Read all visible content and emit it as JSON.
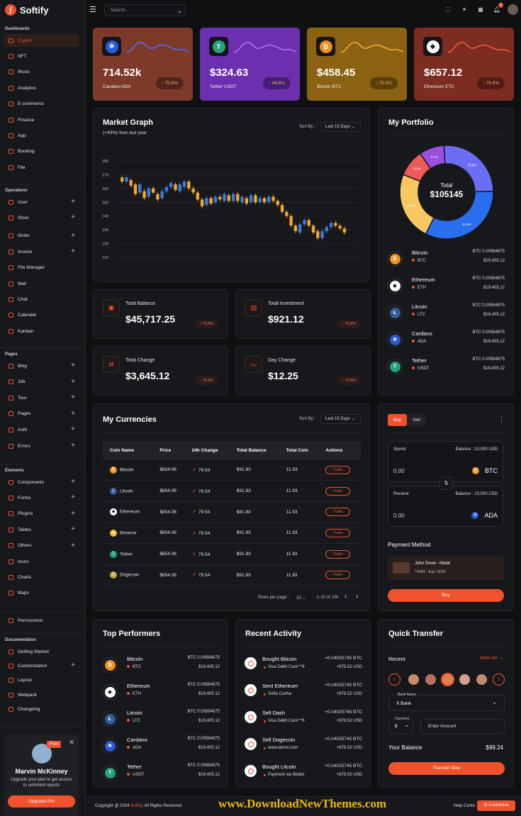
{
  "brand": "Softify",
  "sidebar": {
    "sections": [
      "Dashboards",
      "Operations",
      "Pages",
      "Elements",
      "Documentation"
    ],
    "dashboards": [
      "Crypto",
      "NFT",
      "Music",
      "Analytics",
      "E-commerce",
      "Finance",
      "App",
      "Booking",
      "File"
    ],
    "operations": [
      "User",
      "Store",
      "Order",
      "Invoice",
      "File Manager",
      "Mail",
      "Chat",
      "Calendar",
      "Kanban"
    ],
    "pages": [
      "Blog",
      "Job",
      "Tour",
      "Pages",
      "Auth",
      "Errors"
    ],
    "elements": [
      "Components",
      "Forms",
      "Plugins",
      "Tables",
      "Others",
      "Icons",
      "Charts",
      "Maps",
      "Permissions"
    ],
    "documentation": [
      "Getting Started",
      "Customization",
      "Layout",
      "Webpack",
      "Changelog"
    ],
    "promo": {
      "badge": "Free",
      "name": "Marvin McKinney",
      "desc": "Upgrade your plan to get access to unlimited reports",
      "button": "Upgrade Pro"
    }
  },
  "topbar": {
    "search_placeholder": "Search...",
    "notif_count": "2"
  },
  "stats": [
    {
      "value": "714.52k",
      "label": "Cardano ADA",
      "pct": "75.8%",
      "color": "#7d3a2b",
      "coin": "#2a5bd7",
      "glyph": "✲",
      "line": "#4f6df0"
    },
    {
      "value": "$324.63",
      "label": "Tether USDT",
      "pct": "44.8%",
      "color": "#6b2fb0",
      "coin": "#26a17b",
      "glyph": "T",
      "line": "#b06ff5"
    },
    {
      "value": "$458.45",
      "label": "Bitcoin BTC",
      "pct": "75.8%",
      "color": "#8a6211",
      "coin": "#f0901a",
      "glyph": "₿",
      "line": "#f0b030"
    },
    {
      "value": "$657.12",
      "label": "Ethereum ETC",
      "pct": "75.8%",
      "color": "#7d2c22",
      "coin": "#ffffff",
      "glyph": "◆",
      "line": "#f05a30"
    }
  ],
  "market": {
    "title": "Market Graph",
    "subtitle": "(+43%) than last year",
    "sort_label": "Sort By :",
    "sort_value": "Last 15 Days",
    "yticks": [
      "180",
      "170",
      "160",
      "150",
      "140",
      "130",
      "120",
      "110"
    ]
  },
  "chart_data": {
    "type": "candlestick",
    "title": "Market Graph",
    "y_ticks": [
      180,
      170,
      160,
      150,
      140,
      130,
      120,
      110
    ],
    "ylim": [
      110,
      180
    ],
    "candles": [
      [
        168,
        165
      ],
      [
        165,
        168
      ],
      [
        166,
        162
      ],
      [
        163,
        156
      ],
      [
        157,
        163
      ],
      [
        158,
        153
      ],
      [
        154,
        160
      ],
      [
        160,
        157
      ],
      [
        156,
        152
      ],
      [
        153,
        158
      ],
      [
        158,
        161
      ],
      [
        161,
        164
      ],
      [
        163,
        159
      ],
      [
        158,
        163
      ],
      [
        161,
        165
      ],
      [
        165,
        160
      ],
      [
        160,
        157
      ],
      [
        157,
        152
      ],
      [
        152,
        147
      ],
      [
        148,
        153
      ],
      [
        153,
        149
      ],
      [
        150,
        154
      ],
      [
        154,
        152
      ],
      [
        151,
        156
      ],
      [
        155,
        151
      ],
      [
        151,
        156
      ],
      [
        156,
        151
      ],
      [
        150,
        154
      ],
      [
        153,
        149
      ],
      [
        150,
        155
      ],
      [
        155,
        150
      ],
      [
        150,
        153
      ],
      [
        153,
        150
      ],
      [
        150,
        154
      ],
      [
        154,
        151
      ],
      [
        151,
        148
      ],
      [
        148,
        143
      ],
      [
        143,
        140
      ],
      [
        140,
        133
      ],
      [
        133,
        129
      ],
      [
        128,
        134
      ],
      [
        134,
        137
      ],
      [
        137,
        133
      ],
      [
        133,
        128
      ],
      [
        129,
        124
      ],
      [
        124,
        129
      ],
      [
        129,
        132
      ],
      [
        132,
        135
      ],
      [
        135,
        133
      ],
      [
        133,
        131
      ],
      [
        131,
        128
      ]
    ]
  },
  "balances": [
    {
      "label": "Total Balance",
      "value": "$45,717.25",
      "pct": "75.8%",
      "icon": "▣"
    },
    {
      "label": "Total Investment",
      "value": "$921.12",
      "pct": "75.8%",
      "icon": "▤"
    },
    {
      "label": "Total Change",
      "value": "$3,645.12",
      "pct": "75.8%",
      "icon": "⇄"
    },
    {
      "label": "Day Change",
      "value": "$12.25",
      "pct": "75.8%",
      "icon": "▭"
    }
  ],
  "portfolio": {
    "title": "My Portfolio",
    "total_label": "Total",
    "total_value": "$105145",
    "slices": [
      {
        "label": "8.7%",
        "value": 8.7,
        "color": "#9b4fe0"
      },
      {
        "label": "25.6%",
        "value": 25.6,
        "color": "#6b6df5"
      },
      {
        "label": "32.6%",
        "value": 32.6,
        "color": "#2a6ef0"
      },
      {
        "label": "23.8%",
        "value": 23.8,
        "color": "#f6c85f"
      },
      {
        "label": "9.9%",
        "value": 9.3,
        "color": "#f0595a"
      }
    ],
    "items": [
      {
        "name": "Bitcoin",
        "sym": "BTC",
        "btc": "BTC 0.00584875",
        "usd": "$19,405.12",
        "c": "#f0901a",
        "g": "₿"
      },
      {
        "name": "Ethereum",
        "sym": "ETH",
        "btc": "BTC 0.00584875",
        "usd": "$19,405.12",
        "c": "#ffffff",
        "g": "◆"
      },
      {
        "name": "Litcoin",
        "sym": "LTC",
        "btc": "BTC 0.00584875",
        "usd": "$19,405.12",
        "c": "#345d9d",
        "g": "Ł"
      },
      {
        "name": "Cardano",
        "sym": "ADA",
        "btc": "BTC 0.00584875",
        "usd": "$19,405.12",
        "c": "#2a5bd7",
        "g": "✲"
      },
      {
        "name": "Tether",
        "sym": "USDT",
        "btc": "BTC 0.00584875",
        "usd": "$19,405.12",
        "c": "#26a17b",
        "g": "T"
      }
    ]
  },
  "currencies": {
    "title": "My Currencies",
    "sort_label": "Sort By :",
    "sort_value": "Last 15 Days",
    "headers": [
      "Coin Name",
      "Price",
      "24h Change",
      "Total Balance",
      "Total Coin",
      "Actions"
    ],
    "rows": [
      {
        "name": "Bitcoin",
        "price": "$854.08",
        "change": "79.54",
        "bal": "$91.83",
        "coin": "11.93",
        "c": "#f0901a",
        "g": "₿"
      },
      {
        "name": "Litcoin",
        "price": "$854.08",
        "change": "79.54",
        "bal": "$91.83",
        "coin": "11.93",
        "c": "#345d9d",
        "g": "Ł"
      },
      {
        "name": "Ethereum",
        "price": "$854.08",
        "change": "79.54",
        "bal": "$91.83",
        "coin": "11.93",
        "c": "#ffffff",
        "g": "◆"
      },
      {
        "name": "Binance",
        "price": "$854.08",
        "change": "79.54",
        "bal": "$91.83",
        "coin": "11.93",
        "c": "#f3ba2f",
        "g": "◈"
      },
      {
        "name": "Tether",
        "price": "$854.08",
        "change": "79.54",
        "bal": "$91.83",
        "coin": "11.93",
        "c": "#26a17b",
        "g": "T"
      },
      {
        "name": "Dogecoin",
        "price": "$854.08",
        "change": "79.54",
        "bal": "$91.83",
        "coin": "11.93",
        "c": "#c2a633",
        "g": "D"
      }
    ],
    "trade_label": "Trade",
    "rows_per_page": "Rows per page :",
    "rows_value": "10",
    "range": "1-10 of 100"
  },
  "exchange": {
    "buy_tab": "Buy",
    "sell_tab": "Sell",
    "spend": "Spend",
    "receive": "Receive",
    "balance": "Balance : 10,000 USD",
    "zero": "0.00",
    "from": "BTC",
    "to": "ADA",
    "payment_title": "Payment Method",
    "card_name": "John Snow - Metal",
    "card_info": "**4291 - Exp: 12/26",
    "buy_button": "Buy"
  },
  "performers": {
    "title": "Top Performers"
  },
  "activity": {
    "title": "Recent Activity",
    "items": [
      {
        "t": "Bought Bitcoin",
        "s": "Visa Debit Card **6",
        "a": "+0.04025745 BTC",
        "u": "+878.52 USD"
      },
      {
        "t": "Sent Ethereum",
        "s": "Sofia Cunha",
        "a": "+0.04025745 BTC",
        "u": "+878.52 USD"
      },
      {
        "t": "Sell Dash",
        "s": "Visa Debit Card **6",
        "a": "+0.04025745 BTC",
        "u": "+878.52 USD"
      },
      {
        "t": "Sell Dogecoin",
        "s": "www.demo.com",
        "a": "+0.04025745 BTC",
        "u": "+878.52 USD"
      },
      {
        "t": "Bought Litcoin",
        "s": "Payment via Wallet",
        "a": "+0.04025745 BTC",
        "u": "+878.52 USD"
      }
    ]
  },
  "transfer": {
    "title": "Quick Transfer",
    "recent": "Recent",
    "view_all": "View All",
    "bank_label": "Bank Name",
    "bank_value": "X Bank",
    "currency_label": "Currency",
    "currency_value": "$",
    "amount_placeholder": "Enter Amount",
    "balance_label": "Your Balance",
    "balance_value": "$99.24",
    "button": "Transfer Now"
  },
  "footer": {
    "copyright": "Copyright @ 2024",
    "brand": "Softify",
    "rights": ". All Rights Reserved",
    "help": "Help Cente",
    "customize": "Customize",
    "watermark": "www.DownloadNewThemes.com"
  }
}
